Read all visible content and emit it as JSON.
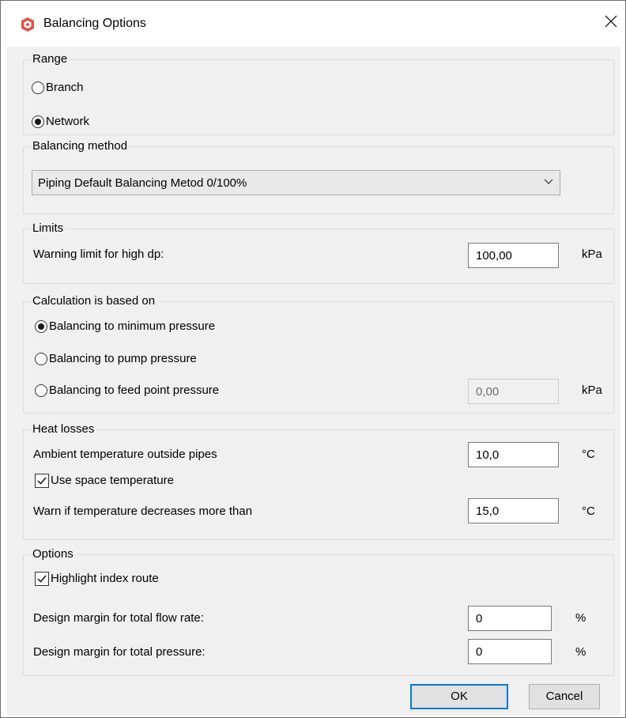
{
  "window": {
    "title": "Balancing Options",
    "close_icon": "close-icon",
    "app_icon": "app-logo-icon",
    "accent": "#e0524c"
  },
  "range": {
    "label": "Range",
    "options": [
      {
        "label": "Branch",
        "selected": false
      },
      {
        "label": "Network",
        "selected": true
      }
    ]
  },
  "balancing_method": {
    "label": "Balancing method",
    "selected": "Piping Default Balancing Metod 0/100%"
  },
  "limits": {
    "label": "Limits",
    "warning_label": "Warning limit for high dp:",
    "warning_value": "100,00",
    "warning_unit": "kPa"
  },
  "calculation": {
    "label": "Calculation is based on",
    "options": [
      {
        "label": "Balancing to minimum pressure",
        "selected": true
      },
      {
        "label": "Balancing to pump pressure",
        "selected": false
      },
      {
        "label": "Balancing to feed point pressure",
        "selected": false
      }
    ],
    "feed_value": "0,00",
    "feed_unit": "kPa"
  },
  "heat_losses": {
    "label": "Heat losses",
    "ambient_label": "Ambient temperature outside pipes",
    "ambient_value": "10,0",
    "ambient_unit": "°C",
    "use_space_label": "Use space temperature",
    "use_space_checked": true,
    "warn_label": "Warn if temperature decreases more than",
    "warn_value": "15,0",
    "warn_unit": "°C"
  },
  "options": {
    "label": "Options",
    "highlight_label": "Highlight index route",
    "highlight_checked": true,
    "flow_label": "Design margin for total flow rate:",
    "flow_value": "0",
    "flow_unit": "%",
    "pressure_label": "Design margin for total pressure:",
    "pressure_value": "0",
    "pressure_unit": "%"
  },
  "buttons": {
    "ok": "OK",
    "cancel": "Cancel"
  }
}
